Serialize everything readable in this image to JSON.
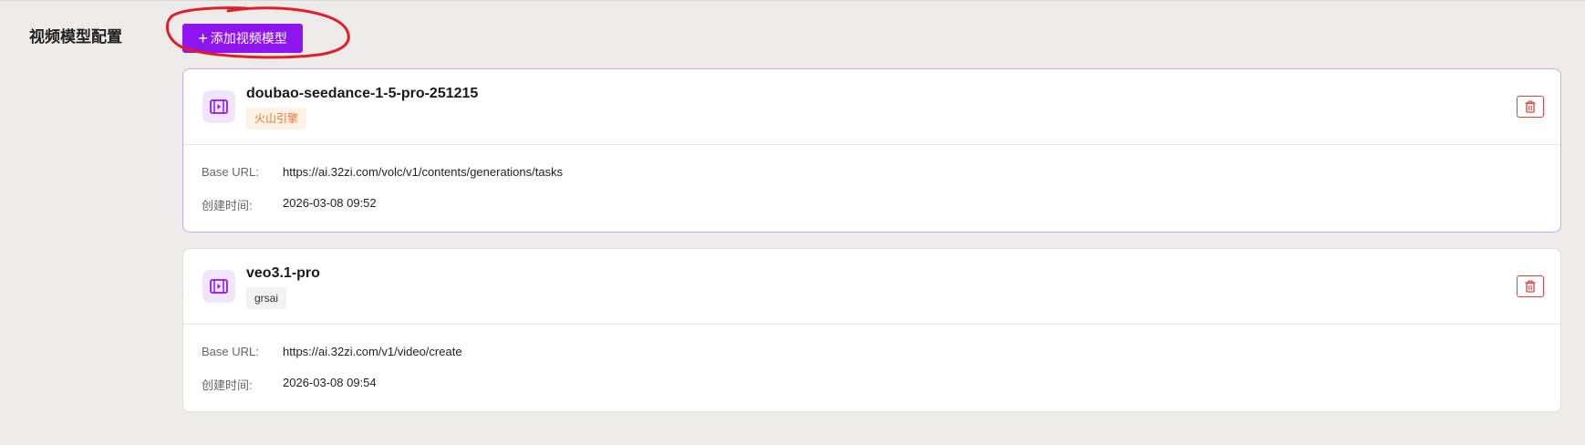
{
  "section": {
    "label": "视频模型配置",
    "add_button_label": "添加视频模型",
    "add_button_icon": "+"
  },
  "colors": {
    "accent": "#8f15f0",
    "annotation": "#e01e2a",
    "delete": "#e04040"
  },
  "models": [
    {
      "name": "doubao-seedance-1-5-pro-251215",
      "provider": "火山引擎",
      "base_url_label": "Base URL:",
      "base_url": "https://ai.32zi.com/volc/v1/contents/generations/tasks",
      "created_label": "创建时间:",
      "created_at": "2026-03-08 09:52",
      "icon": "video-icon",
      "delete_icon": "trash-icon"
    },
    {
      "name": "veo3.1-pro",
      "provider": "grsai",
      "base_url_label": "Base URL:",
      "base_url": "https://ai.32zi.com/v1/video/create",
      "created_label": "创建时间:",
      "created_at": "2026-03-08 09:54",
      "icon": "video-icon",
      "delete_icon": "trash-icon"
    }
  ]
}
